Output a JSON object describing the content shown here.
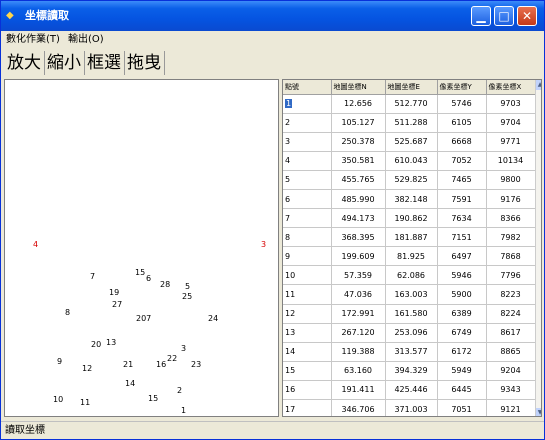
{
  "window": {
    "title": "坐標讀取",
    "icon": "app-icon",
    "buttons": {
      "minimize": "▁",
      "maximize": "□",
      "close": "✕"
    }
  },
  "menu": [
    "數化作業(T)",
    "輸出(O)"
  ],
  "toolbar": [
    "放大",
    "縮小",
    "框選",
    "拖曳"
  ],
  "canvas": {
    "points": [
      {
        "label": "4",
        "color": "red"
      },
      {
        "label": "3",
        "color": "red"
      },
      {
        "label": "7",
        "color": "black"
      },
      {
        "label": "15",
        "color": "black"
      },
      {
        "label": "6",
        "color": "black"
      },
      {
        "label": "28",
        "color": "black"
      },
      {
        "label": "5",
        "color": "black"
      },
      {
        "label": "25",
        "color": "black"
      },
      {
        "label": "19",
        "color": "black"
      },
      {
        "label": "27",
        "color": "black"
      },
      {
        "label": "8",
        "color": "black"
      },
      {
        "label": "207",
        "color": "black"
      },
      {
        "label": "24",
        "color": "black"
      },
      {
        "label": "20",
        "color": "black"
      },
      {
        "label": "13",
        "color": "black"
      },
      {
        "label": "3",
        "color": "black"
      },
      {
        "label": "9",
        "color": "black"
      },
      {
        "label": "12",
        "color": "black"
      },
      {
        "label": "21",
        "color": "black"
      },
      {
        "label": "16",
        "color": "black"
      },
      {
        "label": "22",
        "color": "black"
      },
      {
        "label": "23",
        "color": "black"
      },
      {
        "label": "14",
        "color": "black"
      },
      {
        "label": "2",
        "color": "black"
      },
      {
        "label": "10",
        "color": "black"
      },
      {
        "label": "11",
        "color": "black"
      },
      {
        "label": "15",
        "color": "black"
      },
      {
        "label": "1",
        "color": "black"
      }
    ]
  },
  "grid": {
    "headers": [
      "點號",
      "地圖坐標N",
      "地圖坐標E",
      "像素坐標Y",
      "像素坐標X"
    ],
    "rows": [
      [
        "1",
        "12.656",
        "512.770",
        "5746",
        "9703"
      ],
      [
        "2",
        "105.127",
        "511.288",
        "6105",
        "9704"
      ],
      [
        "3",
        "250.378",
        "525.687",
        "6668",
        "9771"
      ],
      [
        "4",
        "350.581",
        "610.043",
        "7052",
        "10134"
      ],
      [
        "5",
        "455.765",
        "529.825",
        "7465",
        "9800"
      ],
      [
        "6",
        "485.990",
        "382.148",
        "7591",
        "9176"
      ],
      [
        "7",
        "494.173",
        "190.862",
        "7634",
        "8366"
      ],
      [
        "8",
        "368.395",
        "181.887",
        "7151",
        "7982"
      ],
      [
        "9",
        "199.609",
        "81.925",
        "6497",
        "7868"
      ],
      [
        "10",
        "57.359",
        "62.086",
        "5946",
        "7796"
      ],
      [
        "11",
        "47.036",
        "163.003",
        "5900",
        "8223"
      ],
      [
        "12",
        "172.991",
        "161.580",
        "6389",
        "8224"
      ],
      [
        "13",
        "267.120",
        "253.096",
        "6749",
        "8617"
      ],
      [
        "14",
        "119.388",
        "313.577",
        "6172",
        "8865"
      ],
      [
        "15",
        "63.160",
        "394.329",
        "5949",
        "9204"
      ],
      [
        "16",
        "191.411",
        "425.446",
        "6445",
        "9343"
      ],
      [
        "17",
        "346.706",
        "371.003",
        "7051",
        "9121"
      ]
    ]
  },
  "status": "讀取坐標"
}
